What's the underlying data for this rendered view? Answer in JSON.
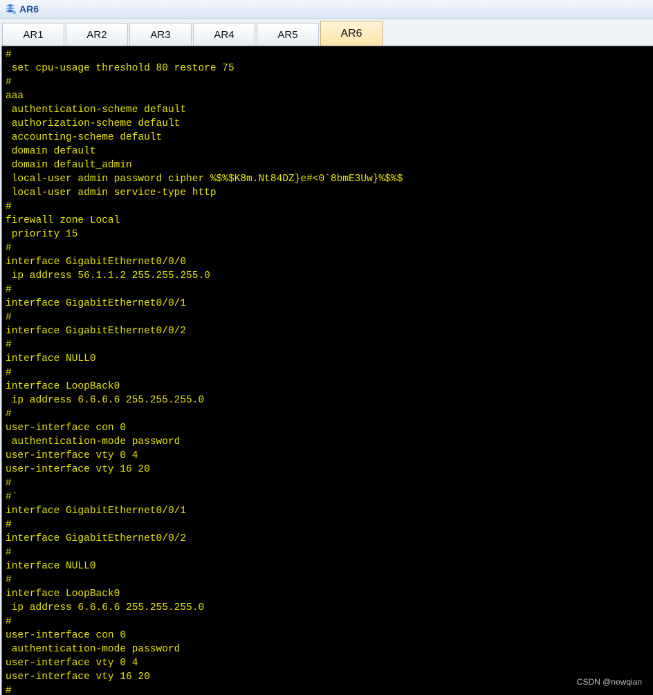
{
  "window": {
    "title": "AR6",
    "icon": "network-device-icon",
    "accent_color": "#1d4f9a"
  },
  "tabs": [
    {
      "label": "AR1",
      "active": false
    },
    {
      "label": "AR2",
      "active": false
    },
    {
      "label": "AR3",
      "active": false
    },
    {
      "label": "AR4",
      "active": false
    },
    {
      "label": "AR5",
      "active": false
    },
    {
      "label": "AR6",
      "active": true
    }
  ],
  "terminal": {
    "text_color": "#e6e600",
    "background_color": "#000000",
    "lines": [
      "#",
      " set cpu-usage threshold 80 restore 75",
      "#",
      "aaa",
      " authentication-scheme default",
      " authorization-scheme default",
      " accounting-scheme default",
      " domain default",
      " domain default_admin",
      " local-user admin password cipher %$%$K8m.Nt84DZ}e#<0`8bmE3Uw}%$%$",
      " local-user admin service-type http",
      "#",
      "firewall zone Local",
      " priority 15",
      "#",
      "interface GigabitEthernet0/0/0",
      " ip address 56.1.1.2 255.255.255.0",
      "#",
      "interface GigabitEthernet0/0/1",
      "#",
      "interface GigabitEthernet0/0/2",
      "#",
      "interface NULL0",
      "#",
      "interface LoopBack0",
      " ip address 6.6.6.6 255.255.255.0",
      "#",
      "user-interface con 0",
      " authentication-mode password",
      "user-interface vty 0 4",
      "user-interface vty 16 20",
      "#",
      "#`",
      "interface GigabitEthernet0/0/1",
      "#",
      "interface GigabitEthernet0/0/2",
      "#",
      "interface NULL0",
      "#",
      "interface LoopBack0",
      " ip address 6.6.6.6 255.255.255.0",
      "#",
      "user-interface con 0",
      " authentication-mode password",
      "user-interface vty 0 4",
      "user-interface vty 16 20",
      "#"
    ]
  },
  "watermark": "CSDN @newqian"
}
